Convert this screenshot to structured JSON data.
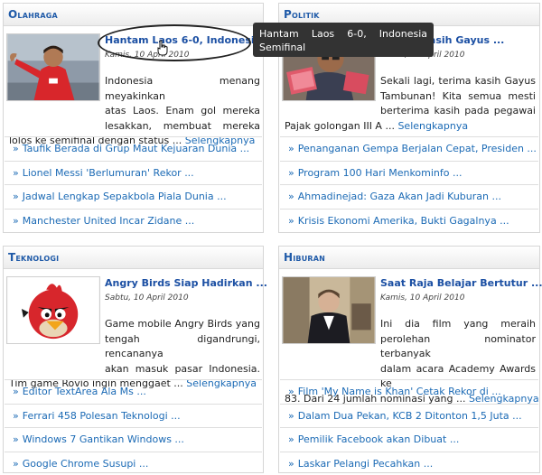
{
  "sections": [
    {
      "key": "olahraga",
      "heading": "Olahraga",
      "headline": "Hantam Laos 6-0, Indonesia ...",
      "date": "Kamis, 10 April 2010",
      "excerpt_lines": [
        "Indonesia menang meyakinkan",
        "atas Laos. Enam gol mereka",
        "lesakkan, membuat mereka"
      ],
      "excerpt_last": "lolos ke semifinal dengan status ...",
      "more": "Selengkapnya",
      "links": [
        "Taufik Berada di Grup Maut Kejuaran Dunia ...",
        "Lionel Messi 'Berlumuran' Rekor ...",
        "Jadwal Lengkap Sepakbola Piala Dunia ...",
        "Manchester United Incar Zidane ..."
      ]
    },
    {
      "key": "politik",
      "heading": "Politik",
      "headline": "Terima Kasih Gayus ...",
      "date": "Kamis, 10 April 2010",
      "excerpt_lines": [
        "Sekali lagi, terima kasih Gayus",
        "Tambunan! Kita semua mesti",
        "berterima kasih pada pegawai"
      ],
      "excerpt_last": "Pajak golongan III A ...",
      "more": "Selengkapnya",
      "links": [
        "Penanganan Gempa Berjalan Cepat, Presiden ...",
        "Program 100 Hari Menkominfo ...",
        "Ahmadinejad: Gaza Akan Jadi Kuburan ...",
        "Krisis Ekonomi Amerika, Bukti Gagalnya ..."
      ]
    },
    {
      "key": "teknologi",
      "heading": "Teknologi",
      "headline": "Angry Birds Siap Hadirkan ...",
      "date": "Sabtu, 10 April 2010",
      "excerpt_lines": [
        "Game mobile Angry Birds yang",
        "tengah digandrungi, rencananya",
        "akan masuk pasar Indonesia."
      ],
      "excerpt_last": "Tim game Rovio ingin menggaet ...",
      "more": "Selengkapnya",
      "links": [
        "Editor TextArea Ala Ms ...",
        "Ferrari 458 Polesan Teknologi ...",
        "Windows 7 Gantikan Windows ...",
        "Google Chrome Susupi ..."
      ]
    },
    {
      "key": "hiburan",
      "heading": "Hiburan",
      "headline": "Saat Raja Belajar Bertutur ...",
      "date": "Kamis, 10 April 2010",
      "excerpt_lines": [
        "Ini dia film yang meraih",
        "perolehan nominator terbanyak",
        "dalam acara Academy Awards ke"
      ],
      "excerpt_last": "83. Dari 24 jumlah nominasi yang ...",
      "more": "Selengkapnya",
      "links": [
        "Film 'My Name is Khan' Cetak Rekor di ...",
        "Dalam Dua Pekan, KCB 2 Ditonton 1,5 Juta ...",
        "Pemilik Facebook akan Dibuat ...",
        "Laskar Pelangi Pecahkan ..."
      ]
    }
  ],
  "tooltip": {
    "text": "Hantam Laos 6-0, Indonesia Semifinal"
  },
  "icons": {
    "list_bullet": "chevron-right-icon",
    "cursor": "hand-pointer-icon"
  },
  "colors": {
    "heading": "#1f5aa8",
    "link": "#1b6ab5",
    "headline": "#1b4fa3",
    "tooltip_bg": "#333333"
  }
}
